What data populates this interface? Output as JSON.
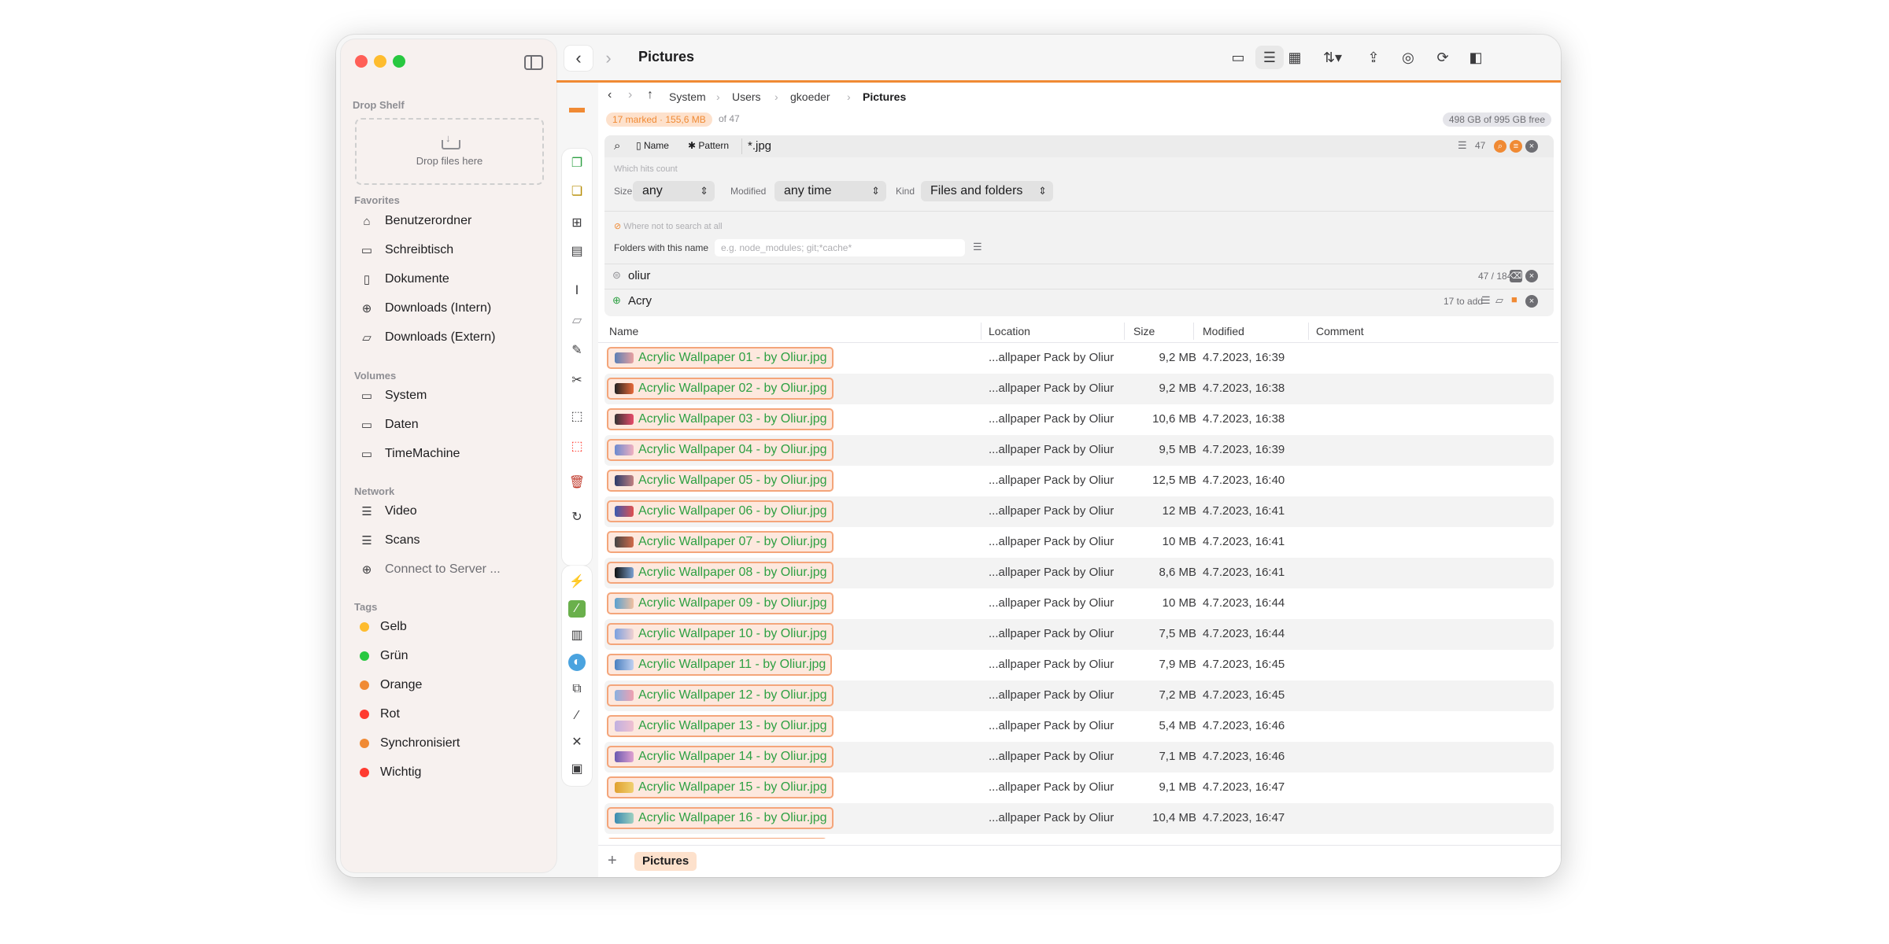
{
  "window": {
    "title": "Pictures"
  },
  "sidebar": {
    "drop_shelf": {
      "label": "Drop Shelf",
      "hint": "Drop files here"
    },
    "favorites": {
      "label": "Favorites",
      "items": [
        {
          "label": "Benutzerordner",
          "icon": "home-icon"
        },
        {
          "label": "Schreibtisch",
          "icon": "desktop-icon"
        },
        {
          "label": "Dokumente",
          "icon": "document-icon"
        },
        {
          "label": "Downloads (Intern)",
          "icon": "download-icon"
        },
        {
          "label": "Downloads (Extern)",
          "icon": "folder-icon"
        }
      ]
    },
    "volumes": {
      "label": "Volumes",
      "items": [
        {
          "label": "System",
          "icon": "drive-icon"
        },
        {
          "label": "Daten",
          "icon": "drive-icon"
        },
        {
          "label": "TimeMachine",
          "icon": "drive-icon"
        }
      ]
    },
    "network": {
      "label": "Network",
      "items": [
        {
          "label": "Video",
          "icon": "server-icon"
        },
        {
          "label": "Scans",
          "icon": "server-icon"
        },
        {
          "label": "Connect to Server ...",
          "icon": "plus-circle-icon"
        }
      ]
    },
    "tags": {
      "label": "Tags",
      "items": [
        {
          "label": "Gelb",
          "color": "#febc2e"
        },
        {
          "label": "Grün",
          "color": "#28c840"
        },
        {
          "label": "Orange",
          "color": "#f08a34"
        },
        {
          "label": "Rot",
          "color": "#ff3b30"
        },
        {
          "label": "Synchronisiert",
          "color": "#f08a34"
        },
        {
          "label": "Wichtig",
          "color": "#ff3b30"
        }
      ]
    }
  },
  "breadcrumb": [
    "System",
    "Users",
    "gkoeder",
    "Pictures"
  ],
  "status": {
    "marked": "17 marked · 155,6 MB",
    "of": "of 47",
    "free": "498 GB of 995 GB free"
  },
  "search": {
    "name_label": "Name",
    "pattern_label": "Pattern",
    "pattern": "*.jpg",
    "count": "47",
    "which_hits": "Which hits count",
    "size_label": "Size",
    "size_value": "any",
    "modified_label": "Modified",
    "modified_value": "any time",
    "kind_label": "Kind",
    "kind_value": "Files and folders",
    "where_not": "Where not to search at all",
    "folders_label": "Folders with this name",
    "folders_placeholder": "e.g. node_modules; git;*cache*",
    "filter1": {
      "text": "oliur",
      "count": "47 / 184"
    },
    "filter2": {
      "text": "Acry",
      "count": "17 to add"
    }
  },
  "table": {
    "headers": {
      "name": "Name",
      "location": "Location",
      "size": "Size",
      "modified": "Modified",
      "comment": "Comment"
    },
    "rows": [
      {
        "name": "Acrylic Wallpaper 01 - by Oliur.jpg",
        "location": "...allpaper Pack by Oliur",
        "size": "9,2 MB",
        "modified": "4.7.2023, 16:39"
      },
      {
        "name": "Acrylic Wallpaper 02 - by Oliur.jpg",
        "location": "...allpaper Pack by Oliur",
        "size": "9,2 MB",
        "modified": "4.7.2023, 16:38"
      },
      {
        "name": "Acrylic Wallpaper 03 - by Oliur.jpg",
        "location": "...allpaper Pack by Oliur",
        "size": "10,6 MB",
        "modified": "4.7.2023, 16:38"
      },
      {
        "name": "Acrylic Wallpaper 04 - by Oliur.jpg",
        "location": "...allpaper Pack by Oliur",
        "size": "9,5 MB",
        "modified": "4.7.2023, 16:39"
      },
      {
        "name": "Acrylic Wallpaper 05 - by Oliur.jpg",
        "location": "...allpaper Pack by Oliur",
        "size": "12,5 MB",
        "modified": "4.7.2023, 16:40"
      },
      {
        "name": "Acrylic Wallpaper 06 - by Oliur.jpg",
        "location": "...allpaper Pack by Oliur",
        "size": "12 MB",
        "modified": "4.7.2023, 16:41"
      },
      {
        "name": "Acrylic Wallpaper 07 - by Oliur.jpg",
        "location": "...allpaper Pack by Oliur",
        "size": "10 MB",
        "modified": "4.7.2023, 16:41"
      },
      {
        "name": "Acrylic Wallpaper 08 - by Oliur.jpg",
        "location": "...allpaper Pack by Oliur",
        "size": "8,6 MB",
        "modified": "4.7.2023, 16:41"
      },
      {
        "name": "Acrylic Wallpaper 09 - by Oliur.jpg",
        "location": "...allpaper Pack by Oliur",
        "size": "10 MB",
        "modified": "4.7.2023, 16:44"
      },
      {
        "name": "Acrylic Wallpaper 10 - by Oliur.jpg",
        "location": "...allpaper Pack by Oliur",
        "size": "7,5 MB",
        "modified": "4.7.2023, 16:44"
      },
      {
        "name": "Acrylic Wallpaper 11 - by Oliur.jpg",
        "location": "...allpaper Pack by Oliur",
        "size": "7,9 MB",
        "modified": "4.7.2023, 16:45"
      },
      {
        "name": "Acrylic Wallpaper 12 - by Oliur.jpg",
        "location": "...allpaper Pack by Oliur",
        "size": "7,2 MB",
        "modified": "4.7.2023, 16:45"
      },
      {
        "name": "Acrylic Wallpaper 13 - by Oliur.jpg",
        "location": "...allpaper Pack by Oliur",
        "size": "5,4 MB",
        "modified": "4.7.2023, 16:46"
      },
      {
        "name": "Acrylic Wallpaper 14 - by Oliur.jpg",
        "location": "...allpaper Pack by Oliur",
        "size": "7,1 MB",
        "modified": "4.7.2023, 16:46"
      },
      {
        "name": "Acrylic Wallpaper 15 - by Oliur.jpg",
        "location": "...allpaper Pack by Oliur",
        "size": "9,1 MB",
        "modified": "4.7.2023, 16:47"
      },
      {
        "name": "Acrylic Wallpaper 16 - by Oliur.jpg",
        "location": "...allpaper Pack by Oliur",
        "size": "10,4 MB",
        "modified": "4.7.2023, 16:47"
      }
    ]
  },
  "tabs": {
    "add": "+",
    "current": "Pictures"
  },
  "colors": {
    "accent": "#f08a34",
    "match_text": "#2ea043",
    "marked_bg": "#fde8de"
  }
}
